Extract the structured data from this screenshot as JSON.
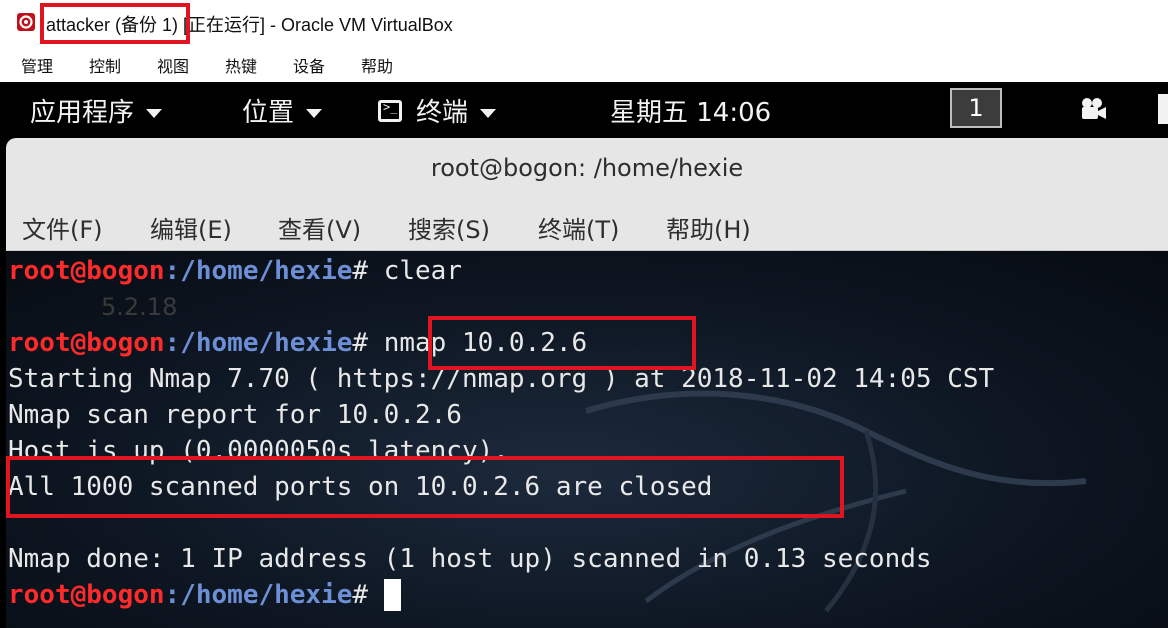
{
  "window": {
    "title": "attacker (备份 1) [正在运行] - Oracle VM VirtualBox",
    "menu": [
      "管理",
      "控制",
      "视图",
      "热键",
      "设备",
      "帮助"
    ]
  },
  "panel": {
    "applications": "应用程序",
    "places": "位置",
    "terminal": "终端",
    "clock": "星期五 14:06",
    "workspace": "1"
  },
  "terminal": {
    "title": "root@bogon: /home/hexie",
    "menu": [
      "文件(F)",
      "编辑(E)",
      "查看(V)",
      "搜索(S)",
      "终端(T)",
      "帮助(H)"
    ],
    "background_text": "5.2.18",
    "prompt": {
      "user": "root@bogon",
      "path": ":/home/hexie",
      "symbol": "# "
    },
    "commands": [
      "clear",
      "nmap 10.0.2.6"
    ],
    "output": [
      "Starting Nmap 7.70 ( https://nmap.org ) at 2018-11-02 14:05 CST",
      "Nmap scan report for 10.0.2.6",
      "Host is up (0.0000050s latency).",
      "All 1000 scanned ports on 10.0.2.6 are closed",
      "",
      "Nmap done: 1 IP address (1 host up) scanned in 0.13 seconds"
    ]
  },
  "colors": {
    "highlight": "#e0151f",
    "prompt_user": "#ff2a2a",
    "prompt_path": "#6d8fd6",
    "panel_bg": "#000000"
  },
  "icons": [
    "virtualbox-app-icon",
    "terminal-icon",
    "camera-icon",
    "chevron-down-icon"
  ]
}
